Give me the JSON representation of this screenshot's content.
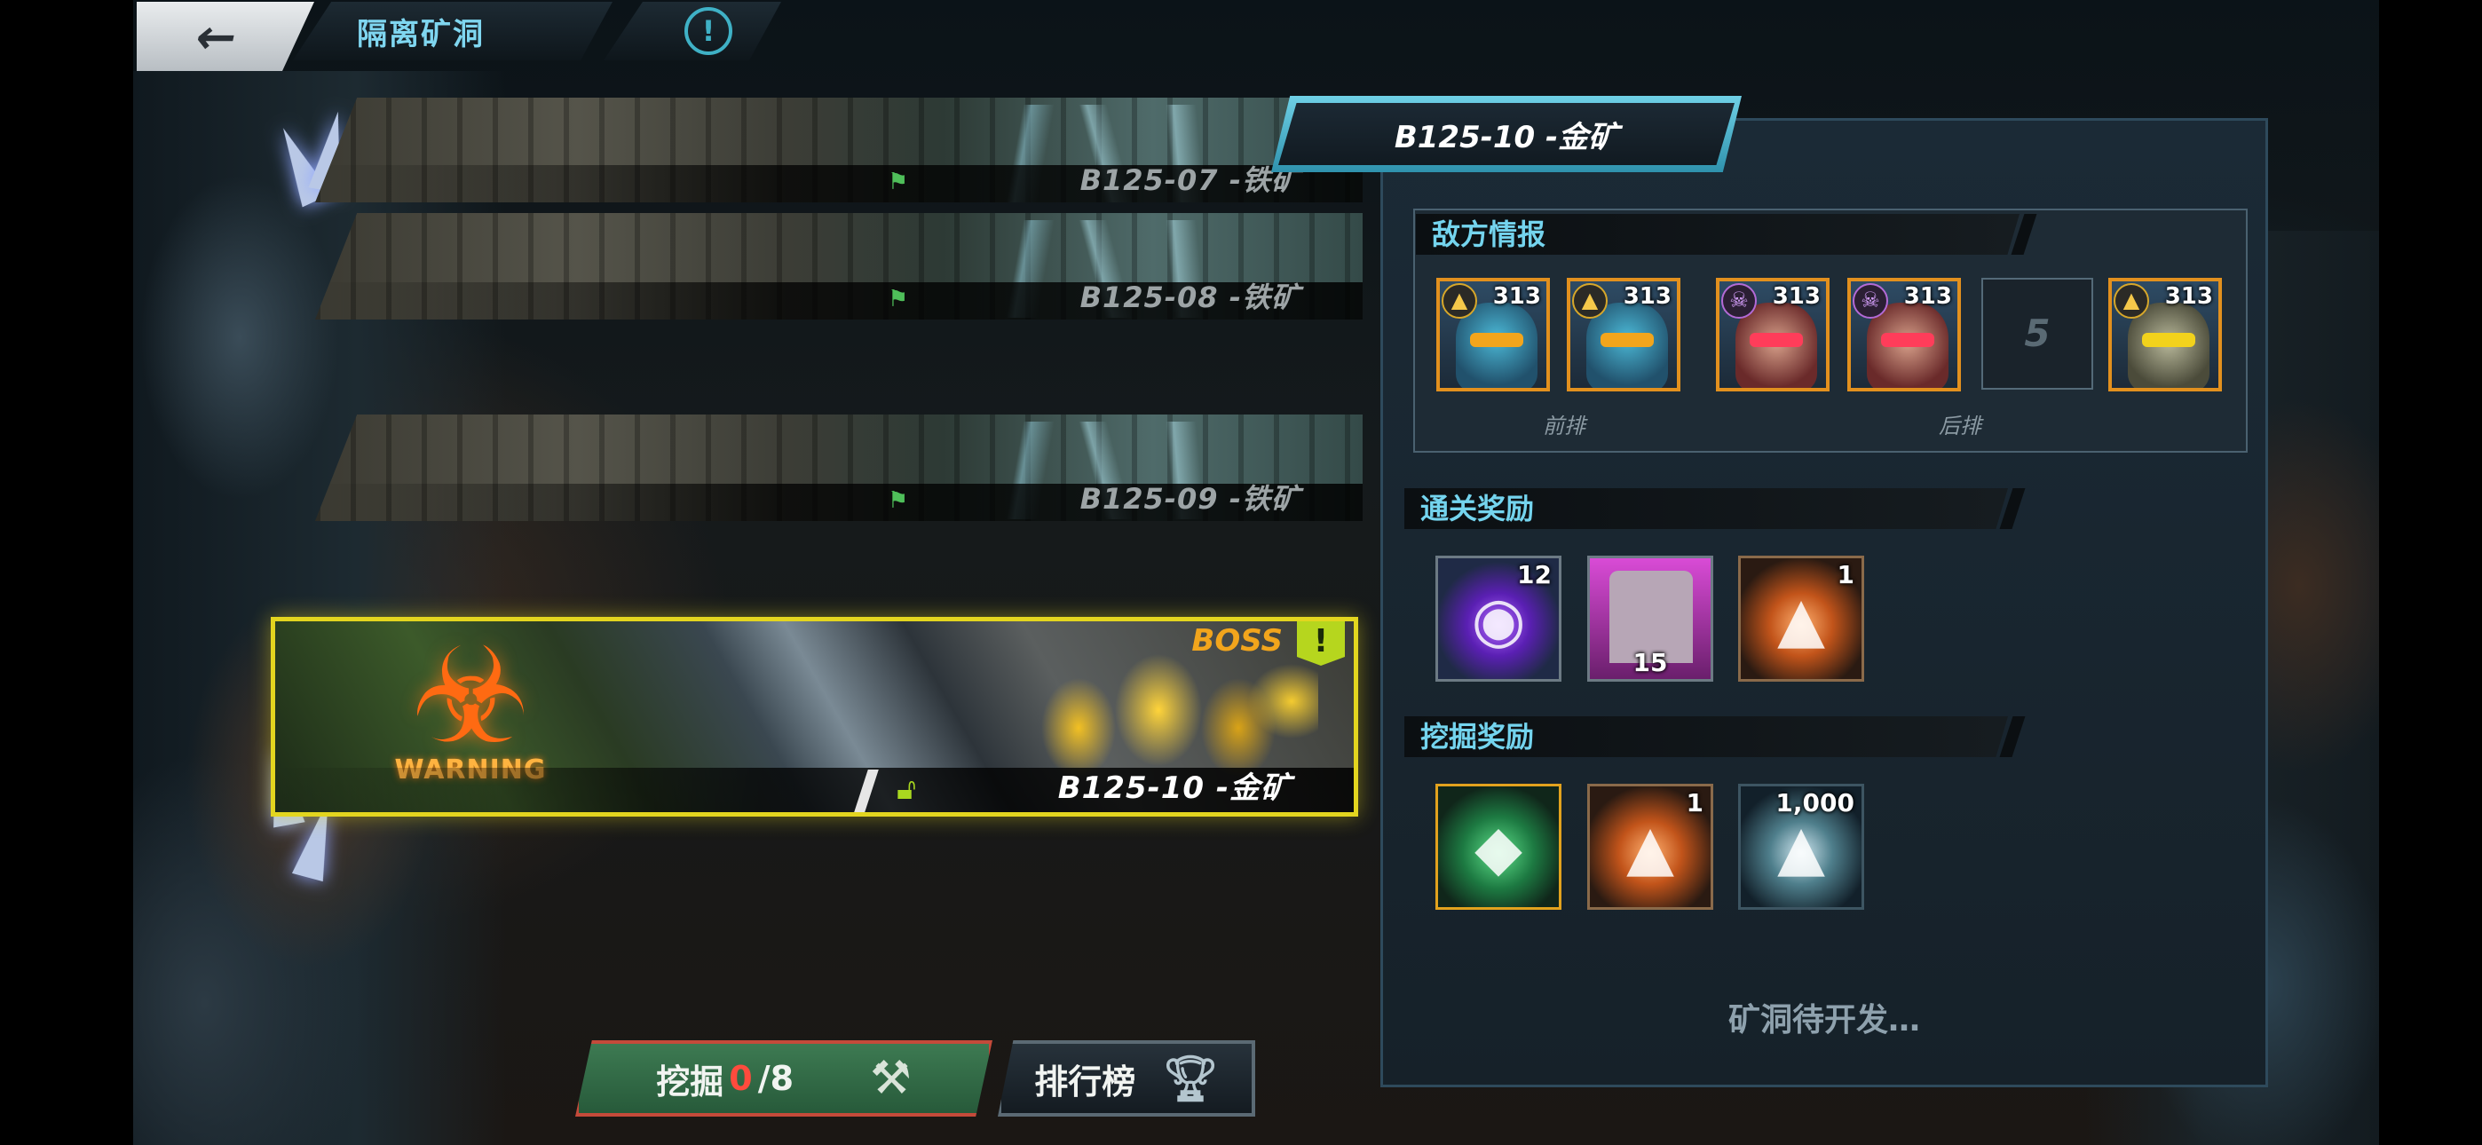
{
  "top_bar": {
    "title": "隔离矿洞",
    "info_icon": "info-icon",
    "back_icon": "back-arrow-icon"
  },
  "levels": [
    {
      "name": "B125-07 -铁矿",
      "status": "cleared"
    },
    {
      "name": "B125-08 -铁矿",
      "status": "cleared"
    },
    {
      "name": "B125-09 -铁矿",
      "status": "cleared"
    },
    {
      "name": "B125-10 -金矿",
      "status": "active",
      "boss_label": "BOSS",
      "warning_label": "WARNING"
    }
  ],
  "buttons": {
    "dig_label": "挖掘",
    "dig_current": "0",
    "dig_total": "/8",
    "rank_label": "排行榜"
  },
  "panel": {
    "header": "B125-10 -金矿",
    "enemy_section": "敌方情报",
    "front_label": "前排",
    "back_label": "后排",
    "enemies": [
      {
        "level": "313",
        "faction": "gold",
        "portrait": "blue-robot"
      },
      {
        "level": "313",
        "faction": "gold",
        "portrait": "blue-robot"
      },
      {
        "level": "313",
        "faction": "purple",
        "portrait": "red-mask"
      },
      {
        "level": "313",
        "faction": "purple",
        "portrait": "red-mask"
      },
      {
        "empty": "5"
      },
      {
        "level": "313",
        "faction": "gold",
        "portrait": "mech"
      }
    ],
    "clear_rewards_section": "通关奖励",
    "clear_rewards": [
      {
        "item": "purple-core",
        "qty": "12"
      },
      {
        "item": "hero-card",
        "qty": "15"
      },
      {
        "item": "orange-chip",
        "qty": "1"
      }
    ],
    "dig_rewards_section": "挖掘奖励",
    "dig_rewards": [
      {
        "item": "green-crystal",
        "qty": ""
      },
      {
        "item": "orange-chip",
        "qty": "1"
      },
      {
        "item": "silver-chip",
        "qty": "1,000"
      }
    ],
    "status_text": "矿洞待开发…"
  },
  "colors": {
    "accent_cyan": "#74d4ee",
    "active_border": "#e3d51f",
    "dig_red": "#ff4b3d",
    "enemy_frame": "#e2901e"
  }
}
